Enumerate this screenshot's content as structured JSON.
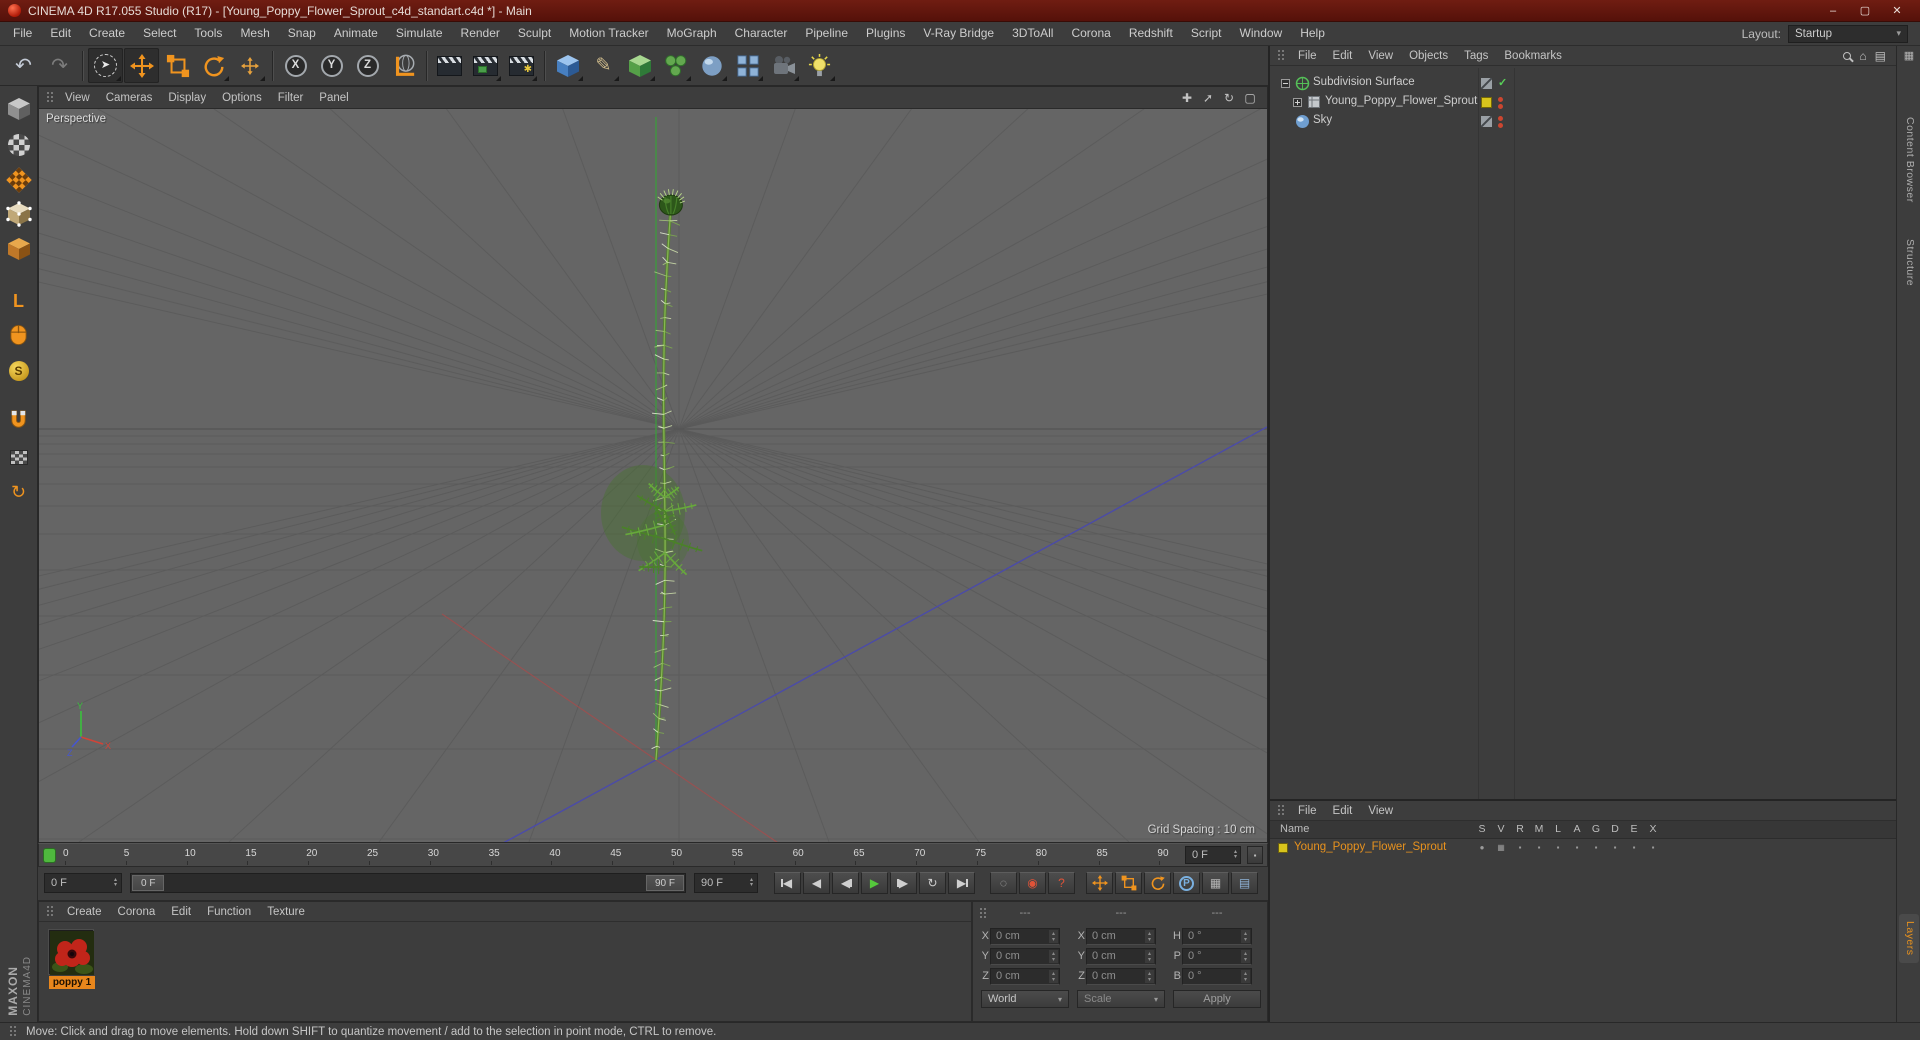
{
  "window": {
    "title": "CINEMA 4D R17.055 Studio (R17) - [Young_Poppy_Flower_Sprout_c4d_standart.c4d *] - Main",
    "minimize": "–",
    "maximize": "▢",
    "close": "✕"
  },
  "menu_bar": {
    "items": [
      "File",
      "Edit",
      "Create",
      "Select",
      "Tools",
      "Mesh",
      "Snap",
      "Animate",
      "Simulate",
      "Render",
      "Sculpt",
      "Motion Tracker",
      "MoGraph",
      "Character",
      "Pipeline",
      "Plugins",
      "V-Ray Bridge",
      "3DToAll",
      "Corona",
      "Redshift",
      "Script",
      "Window",
      "Help"
    ],
    "layout_label": "Layout:",
    "layout_value": "Startup"
  },
  "toolbar": {
    "icons": [
      {
        "name": "undo-button",
        "kind": "glyph",
        "glyph": "↶",
        "color": "#c3cad5",
        "size": 20
      },
      {
        "name": "redo-button",
        "kind": "glyph",
        "glyph": "↷",
        "color": "#7c7c7c",
        "size": 20
      },
      {
        "name": "sep-1",
        "kind": "sep"
      },
      {
        "name": "live-selection-tool",
        "kind": "ringglyph",
        "glyph": "➤",
        "color": "#e8e8e8",
        "flyout": true,
        "pressed": true
      },
      {
        "name": "move-tool",
        "kind": "move",
        "color": "#f0941f",
        "pressed": true
      },
      {
        "name": "scale-tool",
        "kind": "scale",
        "color": "#f0941f"
      },
      {
        "name": "rotate-tool",
        "kind": "rotate",
        "color": "#f0941f",
        "flyout": true
      },
      {
        "name": "last-used-tool",
        "kind": "move",
        "color": "#e8a23c",
        "small": true,
        "flyout": true
      },
      {
        "name": "sep-2",
        "kind": "sep"
      },
      {
        "name": "lock-x-button",
        "kind": "axis",
        "letter": "X"
      },
      {
        "name": "lock-y-button",
        "kind": "axis",
        "letter": "Y"
      },
      {
        "name": "lock-z-button",
        "kind": "axis",
        "letter": "Z"
      },
      {
        "name": "coordinate-system-button",
        "kind": "coord"
      },
      {
        "name": "sep-3",
        "kind": "sep"
      },
      {
        "name": "render-view-button",
        "kind": "clapper",
        "variant": "plain"
      },
      {
        "name": "render-region-button",
        "kind": "clapper",
        "variant": "marked",
        "flyout": true
      },
      {
        "name": "render-settings-button",
        "kind": "clapper",
        "variant": "gear",
        "flyout": true
      },
      {
        "name": "sep-4",
        "kind": "sep"
      },
      {
        "name": "add-primitive-button",
        "kind": "cube",
        "top": "#9cc4ee",
        "left": "#477fc0",
        "right": "#2c5a94",
        "flyout": true
      },
      {
        "name": "add-spline-button",
        "kind": "glyph",
        "glyph": "✎",
        "color": "#cdb98a",
        "size": 19,
        "flyout": true
      },
      {
        "name": "add-generator-button",
        "kind": "cube",
        "top": "#a8d890",
        "left": "#55a048",
        "right": "#2f7a38",
        "flyout": true
      },
      {
        "name": "add-modeling-object-button",
        "kind": "cloner",
        "flyout": true
      },
      {
        "name": "add-deformer-button",
        "kind": "ball",
        "flyout": true
      },
      {
        "name": "add-scene-object-button",
        "kind": "grid",
        "flyout": true
      },
      {
        "name": "add-camera-button",
        "kind": "camera",
        "flyout": true
      },
      {
        "name": "add-light-button",
        "kind": "light",
        "flyout": true
      }
    ]
  },
  "left_toolbar": {
    "icons": [
      {
        "name": "make-editable-button",
        "kind": "cube",
        "top": "#c8c8c8",
        "left": "#909090",
        "right": "#606060"
      },
      {
        "name": "model-mode-button",
        "kind": "checker",
        "a": "#d0d0d0",
        "b": "#4a4a4a",
        "shape": "round"
      },
      {
        "name": "texture-mode-button",
        "kind": "checker",
        "a": "#f0941f",
        "b": "#6a3c0c",
        "shape": "diamond"
      },
      {
        "name": "point-mode-button",
        "kind": "cube",
        "top": "#e8dcc0",
        "left": "#c0a878",
        "right": "#8a7448",
        "dots": true
      },
      {
        "name": "polygon-mode-button",
        "kind": "cube",
        "top": "#e8a84c",
        "left": "#c07828",
        "right": "#8a5214"
      },
      {
        "name": "gap-1",
        "kind": "gap"
      },
      {
        "name": "enable-axis-button",
        "kind": "glyph",
        "glyph": "L",
        "color": "#f0941f",
        "size": 18,
        "bold": true
      },
      {
        "name": "tweak-mode-button",
        "kind": "mouse"
      },
      {
        "name": "viewport-solo-button",
        "kind": "coin",
        "letter": "S"
      },
      {
        "name": "gap-2",
        "kind": "gap"
      },
      {
        "name": "snap-button",
        "kind": "magnet"
      },
      {
        "name": "workplane-button",
        "kind": "checker",
        "a": "#c0c0c0",
        "b": "#4a4a4a",
        "shape": "small"
      },
      {
        "name": "quantize-button",
        "kind": "glyph",
        "glyph": "↻",
        "color": "#f0941f",
        "size": 18
      }
    ]
  },
  "viewport": {
    "menu": [
      "View",
      "Cameras",
      "Display",
      "Options",
      "Filter",
      "Panel"
    ],
    "label": "Perspective",
    "grid_spacing": "Grid Spacing : 10 cm",
    "nav_icons": [
      {
        "name": "pan-view-icon",
        "glyph": "✚"
      },
      {
        "name": "zoom-view-icon",
        "glyph": "➚"
      },
      {
        "name": "orbit-view-icon",
        "glyph": "↻"
      },
      {
        "name": "toggle-view-icon",
        "glyph": "▢"
      }
    ],
    "axis_labels": {
      "x": "X",
      "y": "Y",
      "z": "Z"
    }
  },
  "timeline": {
    "tick_labels": [
      "0",
      "5",
      "10",
      "15",
      "20",
      "25",
      "30",
      "35",
      "40",
      "45",
      "50",
      "55",
      "60",
      "65",
      "70",
      "75",
      "80",
      "85",
      "90"
    ],
    "frame_field": "0 F",
    "start_field": "0 F",
    "end_field": "90 F",
    "range_start": "0 F",
    "range_end": "90 F"
  },
  "transport": [
    {
      "name": "goto-start-button",
      "glyph": "◀",
      "bar": "left"
    },
    {
      "name": "play-backwards-button",
      "glyph": "◀"
    },
    {
      "name": "goto-previous-frame-button",
      "glyph": "◀",
      "bar": "right"
    },
    {
      "name": "play-button",
      "glyph": "▶",
      "color": "#55c83c"
    },
    {
      "name": "goto-next-frame-button",
      "glyph": "▶",
      "bar": "left"
    },
    {
      "name": "play-mode-button",
      "glyph": "↻"
    },
    {
      "name": "goto-end-button",
      "glyph": "▶",
      "bar": "right"
    }
  ],
  "record_buttons": [
    {
      "name": "keyframe-selection-button",
      "glyph": "◌",
      "color": "#b5b5b5"
    },
    {
      "name": "record-keyframe-button",
      "glyph": "◉",
      "color": "#e05338"
    },
    {
      "name": "autokeying-button",
      "glyph": "?",
      "color": "#e05338"
    }
  ],
  "key_buttons": [
    {
      "name": "key-position-button",
      "kind": "move"
    },
    {
      "name": "key-scale-button",
      "kind": "scale"
    },
    {
      "name": "key-rotation-button",
      "kind": "rotate"
    },
    {
      "name": "key-parameter-button",
      "kind": "pcircle",
      "letter": "P"
    },
    {
      "name": "key-pla-button",
      "glyph": "▦",
      "color": "#b5b5b5"
    },
    {
      "name": "timeline-window-button",
      "glyph": "▤",
      "color": "#8fb3d8"
    }
  ],
  "materials": {
    "menu": [
      "Create",
      "Corona",
      "Edit",
      "Function",
      "Texture"
    ],
    "items": [
      {
        "name": "poppy 1"
      }
    ]
  },
  "coordinates": {
    "headers": [
      "---",
      "---",
      "---"
    ],
    "rows": [
      {
        "labels": [
          "X",
          "X",
          "H"
        ],
        "values": [
          "0 cm",
          "0 cm",
          "0 °"
        ]
      },
      {
        "labels": [
          "Y",
          "Y",
          "P"
        ],
        "values": [
          "0 cm",
          "0 cm",
          "0 °"
        ]
      },
      {
        "labels": [
          "Z",
          "Z",
          "B"
        ],
        "values": [
          "0 cm",
          "0 cm",
          "0 °"
        ]
      }
    ],
    "space_select": "World",
    "mode_select": "Scale",
    "apply_button": "Apply"
  },
  "object_manager": {
    "menu": [
      "File",
      "Edit",
      "View",
      "Objects",
      "Tags",
      "Bookmarks"
    ],
    "items": [
      {
        "name": "Subdivision Surface",
        "depth": 0,
        "expander": "minus",
        "icon": "subdivision",
        "tagA": "slash",
        "tagB": "check"
      },
      {
        "name": "Young_Poppy_Flower_Sprout",
        "depth": 1,
        "expander": "plus",
        "icon": "object",
        "tagA": "yellow",
        "tagB": "reddots"
      },
      {
        "name": "Sky",
        "depth": 0,
        "expander": "none",
        "icon": "sky",
        "tagA": "slash",
        "tagB": "reddots"
      }
    ]
  },
  "layer_panel": {
    "menu": [
      "File",
      "Edit",
      "View"
    ],
    "name_header": "Name",
    "columns": [
      "S",
      "V",
      "R",
      "M",
      "L",
      "A",
      "G",
      "D",
      "E",
      "X"
    ],
    "rows": [
      {
        "name": "Young_Poppy_Flower_Sprout",
        "color": "#d8c41c"
      }
    ]
  },
  "side_tabs": {
    "icon": "▦",
    "top": [
      "Content Browser",
      "Structure"
    ],
    "bottom": [
      "Layers"
    ]
  },
  "branding": {
    "maxon": "MAXON",
    "cinema": "CINEMA4D"
  },
  "status_bar": {
    "text": "Move: Click and drag to move elements. Hold down SHIFT to quantize movement / add to the selection in point mode, CTRL to remove."
  }
}
